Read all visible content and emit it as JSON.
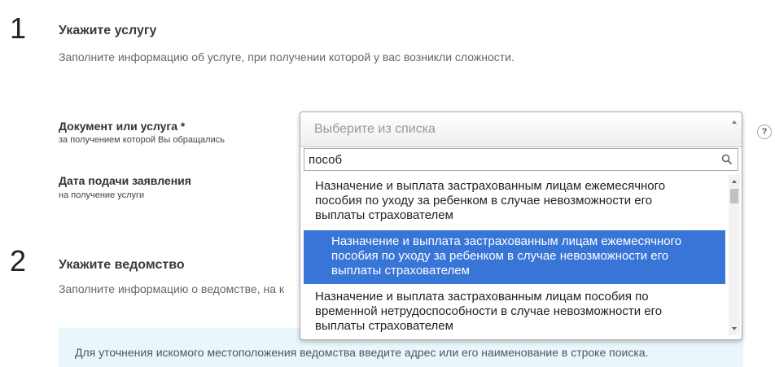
{
  "step1": {
    "number": "1",
    "title": "Укажите услугу",
    "description": "Заполните информацию об услуге, при получении которой у вас возникли сложности."
  },
  "fields": {
    "document": {
      "label": "Документ или услуга *",
      "sublabel": "за получением которой Вы обращались"
    },
    "date": {
      "label": "Дата подачи заявления",
      "sublabel": "на получение услуги"
    }
  },
  "help": {
    "icon": "question-icon",
    "glyph": "?"
  },
  "step2": {
    "number": "2",
    "title": "Укажите ведомство",
    "description": "Заполните информацию о ведомстве, на к"
  },
  "info": {
    "text": "Для уточнения искомого местоположения ведомства введите адрес или его наименование в строке поиска."
  },
  "dropdown": {
    "placeholder": "Выберите из списка",
    "search_value": "пособ",
    "options": [
      {
        "lines": [
          "Назначение и выплата застрахованным лицам ежемесячного",
          "пособия по уходу за ребенком в случае невозможности его",
          "выплаты страхователем"
        ]
      },
      {
        "lines": [
          "Назначение и выплата застрахованным лицам ежемесячного",
          "пособия по уходу за ребенком в случае невозможности его",
          "выплаты страхователем"
        ],
        "highlighted": true
      },
      {
        "lines": [
          "Назначение и выплата застрахованным лицам пособия по",
          "временной нетрудоспособности в случае невозможности его",
          "выплаты страхователем"
        ]
      }
    ]
  },
  "colors": {
    "highlight": "#3875d7",
    "info_bg": "#e9f6fb"
  }
}
